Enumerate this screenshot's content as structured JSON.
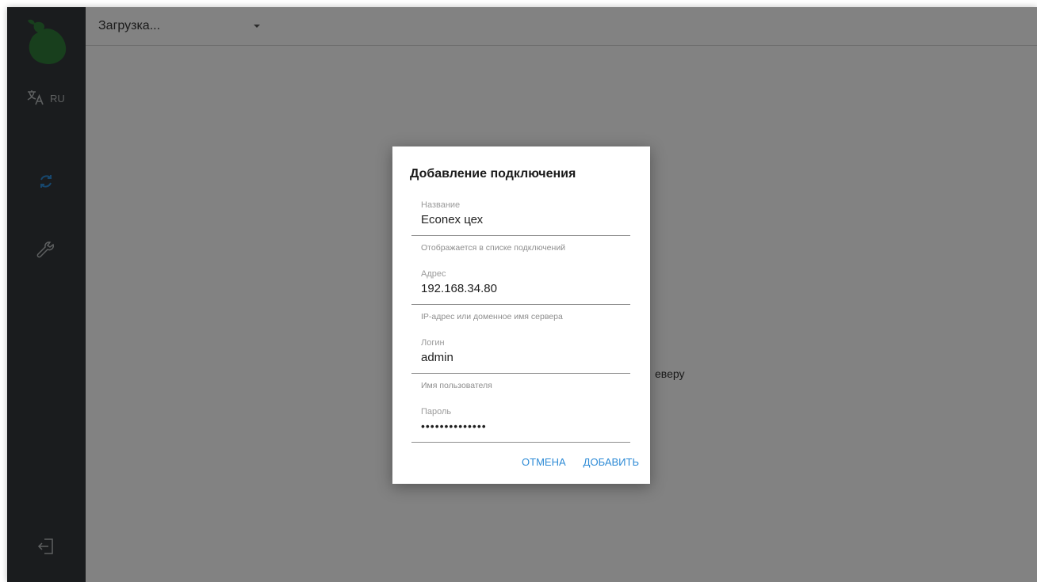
{
  "sidebar": {
    "language": "RU"
  },
  "topbar": {
    "connection_select": "Загрузка..."
  },
  "main": {
    "background_message": "еверу"
  },
  "dialog": {
    "title": "Добавление подключения",
    "fields": [
      {
        "label": "Название",
        "value": "Econex цех",
        "help": "Отображается в списке подключений"
      },
      {
        "label": "Адрес",
        "value": "192.168.34.80",
        "help": "IP-адрес или доменное имя сервера"
      },
      {
        "label": "Логин",
        "value": "admin",
        "help": "Имя пользователя"
      },
      {
        "label": "Пароль",
        "value": "••••••••••••••"
      }
    ],
    "cancel_label": "ОТМЕНА",
    "add_label": "ДОБАВИТЬ"
  },
  "colors": {
    "sidebar_bg": "#33383b",
    "brand_green": "#2f7d3a",
    "accent_blue": "#2e8bd6",
    "overlay": "rgba(0,0,0,0.49)"
  }
}
